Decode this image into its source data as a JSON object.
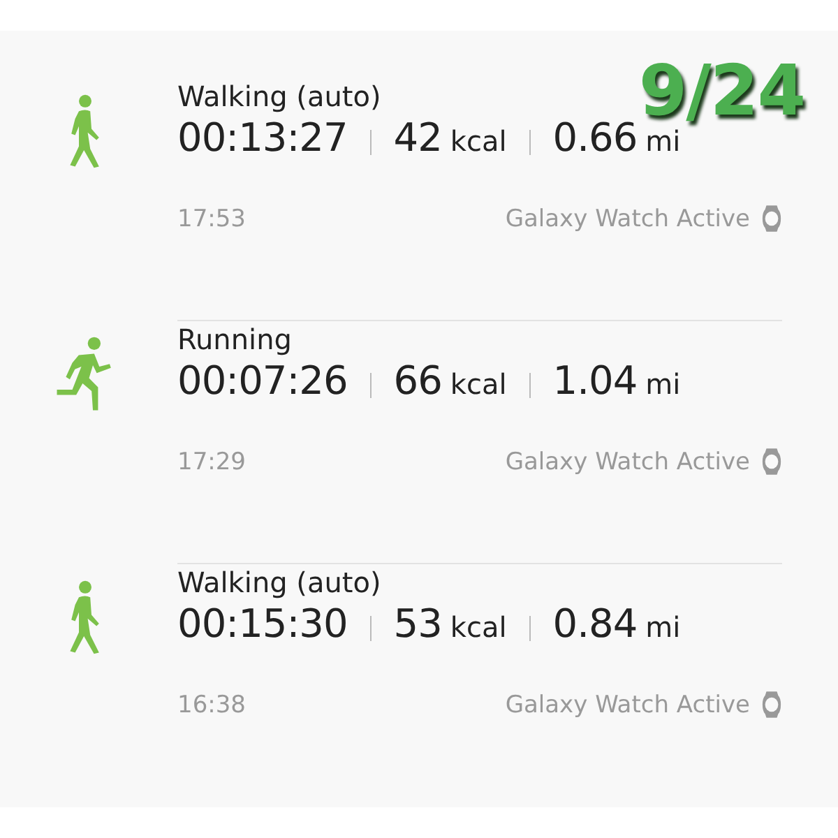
{
  "date_overlay": "9/24",
  "workouts": [
    {
      "kind": "walking",
      "title": "Walking (auto)",
      "duration": "00:13:27",
      "calories": "42",
      "calories_unit": "kcal",
      "distance": "0.66",
      "distance_unit": "mi",
      "time": "17:53",
      "device": "Galaxy Watch Active"
    },
    {
      "kind": "running",
      "title": "Running",
      "duration": "00:07:26",
      "calories": "66",
      "calories_unit": "kcal",
      "distance": "1.04",
      "distance_unit": "mi",
      "time": "17:29",
      "device": "Galaxy Watch Active"
    },
    {
      "kind": "walking",
      "title": "Walking (auto)",
      "duration": "00:15:30",
      "calories": "53",
      "calories_unit": "kcal",
      "distance": "0.84",
      "distance_unit": "mi",
      "time": "16:38",
      "device": "Galaxy Watch Active"
    }
  ]
}
